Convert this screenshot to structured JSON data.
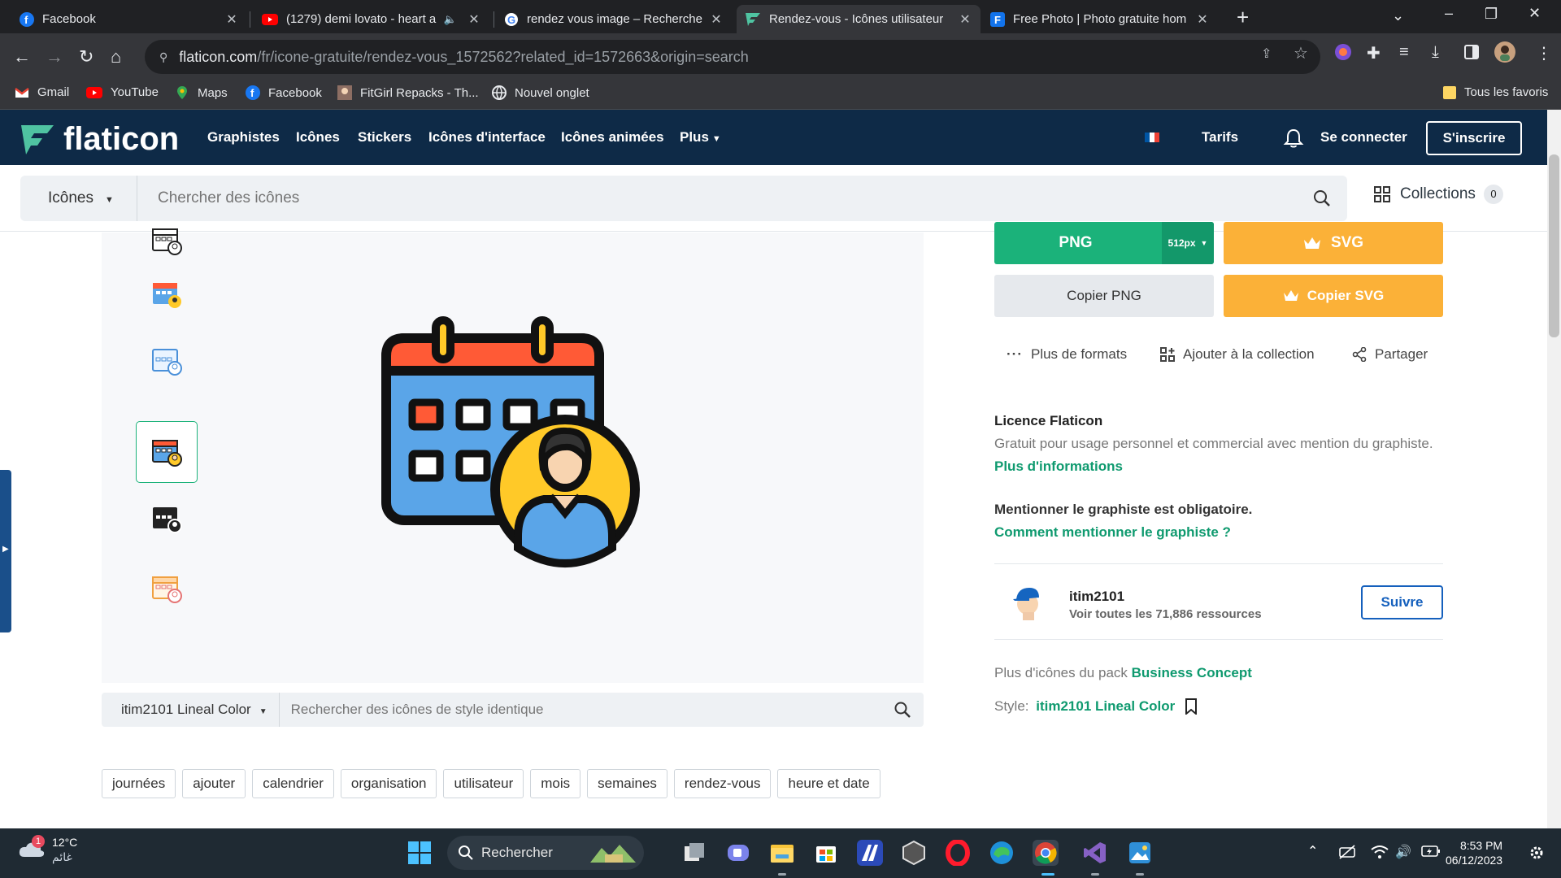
{
  "browser": {
    "tabs": [
      {
        "title": "Facebook",
        "icon": "facebook-icon"
      },
      {
        "title": "(1279) demi lovato - heart a",
        "icon": "youtube-icon"
      },
      {
        "title": "rendez vous image – Recherche",
        "icon": "google-icon"
      },
      {
        "title": "Rendez-vous - Icônes utilisateur",
        "icon": "flaticon-icon"
      },
      {
        "title": "Free Photo | Photo gratuite hom",
        "icon": "freepik-icon"
      }
    ],
    "url_host": "flaticon.com",
    "url_path": "/fr/icone-gratuite/rendez-vous_1572562?related_id=1572663&origin=search",
    "bookmarks": [
      "Gmail",
      "YouTube",
      "Maps",
      "Facebook",
      "FitGirl Repacks - Th...",
      "Nouvel onglet"
    ],
    "all_bookmarks": "Tous les favoris"
  },
  "site": {
    "logo_text": "flaticon",
    "menu": [
      "Graphistes",
      "Icônes",
      "Stickers",
      "Icônes d'interface",
      "Icônes animées",
      "Plus"
    ],
    "pricing": "Tarifs",
    "login": "Se connecter",
    "signup": "S'inscrire",
    "search_type": "Icônes",
    "search_placeholder": "Chercher des icônes",
    "collections_label": "Collections",
    "collections_count": "0"
  },
  "preview": {
    "style_name": "itim2101 Lineal Color",
    "style_search_placeholder": "Rechercher des icônes de style identique",
    "tags": [
      "journées",
      "ajouter",
      "calendrier",
      "organisation",
      "utilisateur",
      "mois",
      "semaines",
      "rendez-vous",
      "heure et date"
    ]
  },
  "download": {
    "png_label": "PNG",
    "png_size": "512px",
    "svg_label": "SVG",
    "copy_png": "Copier PNG",
    "copy_svg": "Copier SVG",
    "more_formats": "Plus de formats",
    "add_collection": "Ajouter à la collection",
    "share": "Partager"
  },
  "license": {
    "title": "Licence Flaticon",
    "text": "Gratuit pour usage personnel et commercial avec mention du graphiste.",
    "more_info": "Plus d'informations",
    "attribution_required": "Mentionner le graphiste est obligatoire.",
    "how_to_attribute": "Comment mentionner le graphiste ?"
  },
  "author": {
    "name": "itim2101",
    "resources_prefix": "Voir toutes les ",
    "resources_count": "71,886",
    "resources_suffix": " ressources",
    "follow": "Suivre"
  },
  "pack": {
    "prefix": "Plus d'icônes du pack ",
    "name": "Business Concept",
    "style_prefix": "Style: ",
    "style_name": "itim2101 Lineal Color"
  },
  "taskbar": {
    "temperature": "12°C",
    "weather_desc": "غائم",
    "weather_badge": "1",
    "search_label": "Rechercher",
    "time": "8:53 PM",
    "date": "06/12/2023"
  },
  "colors": {
    "brand_dark": "#0e2a47",
    "brand_green": "#1bb27a",
    "premium_orange": "#fbb138",
    "link_blue": "#1560bd"
  }
}
